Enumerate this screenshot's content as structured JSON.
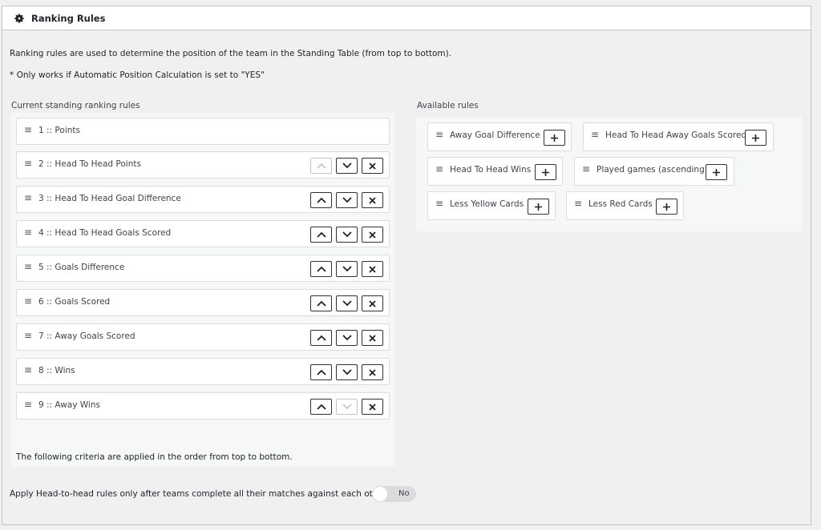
{
  "panel": {
    "title": "Ranking Rules",
    "icon": "gear-icon"
  },
  "description": {
    "line1": "Ranking rules are used to determine the position of the team in the Standing Table (from top to bottom).",
    "line2": "* Only works if Automatic Position Calculation is set to \"YES\""
  },
  "current": {
    "heading": "Current standing ranking rules",
    "rules": [
      {
        "label": "1 :: Points",
        "buttons": false
      },
      {
        "label": "2 :: Head To Head Points",
        "buttons": true,
        "up_enabled": false,
        "down_enabled": true
      },
      {
        "label": "3 :: Head To Head Goal Difference",
        "buttons": true,
        "up_enabled": true,
        "down_enabled": true
      },
      {
        "label": "4 :: Head To Head Goals Scored",
        "buttons": true,
        "up_enabled": true,
        "down_enabled": true
      },
      {
        "label": "5 :: Goals Difference",
        "buttons": true,
        "up_enabled": true,
        "down_enabled": true
      },
      {
        "label": "6 :: Goals Scored",
        "buttons": true,
        "up_enabled": true,
        "down_enabled": true
      },
      {
        "label": "7 :: Away Goals Scored",
        "buttons": true,
        "up_enabled": true,
        "down_enabled": true
      },
      {
        "label": "8 :: Wins",
        "buttons": true,
        "up_enabled": true,
        "down_enabled": true
      },
      {
        "label": "9 :: Away Wins",
        "buttons": true,
        "up_enabled": true,
        "down_enabled": false
      }
    ],
    "footer": "The following criteria are applied in the order from top to bottom."
  },
  "available": {
    "heading": "Available rules",
    "rules": [
      {
        "label": "Away Goal Difference"
      },
      {
        "label": "Head To Head Away Goals Scored"
      },
      {
        "label": "Head To Head Wins"
      },
      {
        "label": "Played games (ascending)"
      },
      {
        "label": "Less Yellow Cards"
      },
      {
        "label": "Less Red Cards"
      }
    ]
  },
  "head_to_head": {
    "label": "Apply Head-to-head rules only after teams complete all their matches against each other",
    "toggle_value": "No",
    "enabled": false
  },
  "colors": {
    "border": "#c3c4c7",
    "button_border": "#2c3338",
    "disabled_border": "#c3c4c7"
  }
}
